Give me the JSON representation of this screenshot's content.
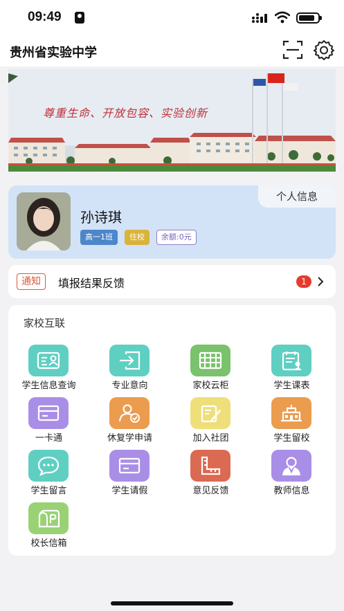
{
  "status_bar": {
    "time": "09:49"
  },
  "app_bar": {
    "title": "贵州省实验中学"
  },
  "banner": {
    "slogan": "尊重生命、开放包容、实验创新"
  },
  "profile": {
    "tab_label": "个人信息",
    "name": "孙诗琪",
    "class_badge": "高一1班",
    "dorm_badge": "住校",
    "balance_badge": "余额:0元"
  },
  "notice": {
    "tag": "通知",
    "text": "填报结果反馈",
    "count": "1"
  },
  "services": {
    "section_title": "家校互联",
    "items": [
      {
        "label": "学生信息查询",
        "icon": "id-card-icon",
        "color": "#5fcfc2"
      },
      {
        "label": "专业意向",
        "icon": "login-arrow-icon",
        "color": "#5fcfc2"
      },
      {
        "label": "家校云柜",
        "icon": "cabinet-icon",
        "color": "#7ac26b"
      },
      {
        "label": "学生课表",
        "icon": "schedule-icon",
        "color": "#5fcfc2"
      },
      {
        "label": "一卡通",
        "icon": "card-icon",
        "color": "#a98ee8"
      },
      {
        "label": "休复学申请",
        "icon": "user-check-icon",
        "color": "#eb9c4e"
      },
      {
        "label": "加入社团",
        "icon": "edit-icon",
        "color": "#eedf7a"
      },
      {
        "label": "学生留校",
        "icon": "school-building-icon",
        "color": "#eb9c4e"
      },
      {
        "label": "学生留言",
        "icon": "chat-bubble-icon",
        "color": "#5fcfc2"
      },
      {
        "label": "学生请假",
        "icon": "card-icon",
        "color": "#a98ee8"
      },
      {
        "label": "意见反馈",
        "icon": "ruler-icon",
        "color": "#db6a52"
      },
      {
        "label": "教师信息",
        "icon": "teacher-icon",
        "color": "#a98ee8"
      },
      {
        "label": "校长信箱",
        "icon": "mailbox-icon",
        "color": "#9ad175"
      }
    ]
  }
}
